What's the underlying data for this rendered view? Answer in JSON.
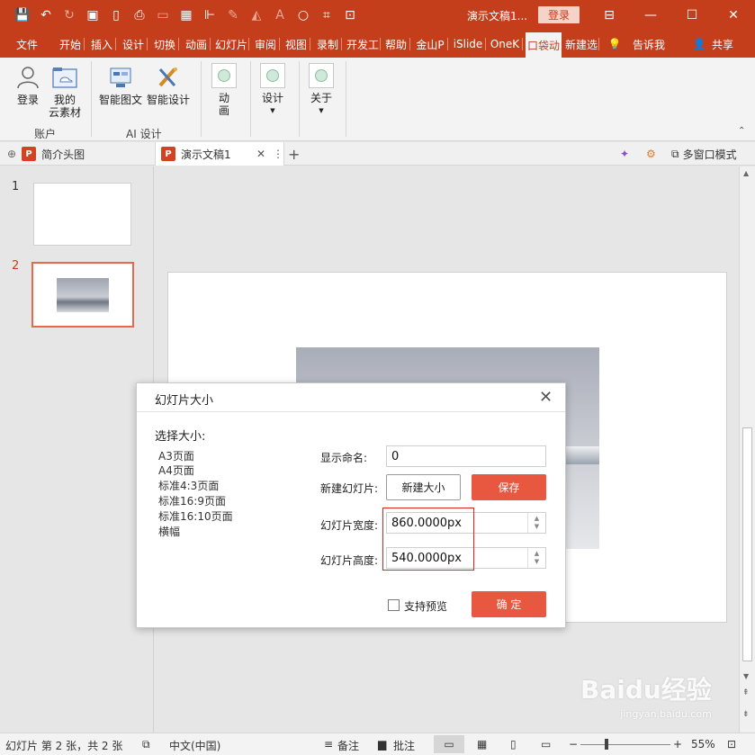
{
  "app": {
    "title": "演示文稿1...",
    "login_button": "登录"
  },
  "ribbon_tabs": [
    "文件",
    "开始",
    "插入",
    "设计",
    "切换",
    "动画",
    "幻灯片",
    "审阅",
    "视图",
    "录制",
    "开发工",
    "帮助",
    "金山P",
    "iSlide",
    "OneK",
    "口袋动",
    "新建选",
    "告诉我",
    "共享"
  ],
  "ribbon": {
    "login": "登录",
    "my_material_line1": "我的",
    "my_material_line2": "云素材",
    "group_account": "账户",
    "smart_graphic": "智能图文",
    "smart_design": "智能设计",
    "group_ai": "AI 设计",
    "animation_line1": "动",
    "animation_line2": "画",
    "design": "设计",
    "about": "关于"
  },
  "doc_tabs": {
    "tab1": "简介头图",
    "tab2": "演示文稿1",
    "window_mode": "多窗口模式"
  },
  "thumbnails": {
    "num1": "1",
    "num2": "2"
  },
  "dialog": {
    "title": "幻灯片大小",
    "choose_size": "选择大小:",
    "options": [
      "A3页面",
      "A4页面",
      "标准4:3页面",
      "标准16:9页面",
      "标准16:10页面",
      "横幅"
    ],
    "display_name_label": "显示命名:",
    "display_name_value": "0",
    "new_slide_label": "新建幻灯片:",
    "new_size_button": "新建大小",
    "save_button": "保存",
    "width_label": "幻灯片宽度:",
    "width_value": "860.0000px",
    "height_label": "幻灯片高度:",
    "height_value": "540.0000px",
    "preview_checkbox_label": "支持预览",
    "ok_button": "确 定"
  },
  "status": {
    "slide_info": "幻灯片 第 2 张，共 2 张",
    "language": "中文(中国)",
    "notes": "备注",
    "comments": "批注",
    "zoom": "55%"
  },
  "watermark": {
    "logo": "Baidu经验",
    "url": "jingyan.baidu.com"
  },
  "colors": {
    "brand": "#c43e1c",
    "accent_button": "#e8573f",
    "highlight_box": "#d9231c"
  }
}
